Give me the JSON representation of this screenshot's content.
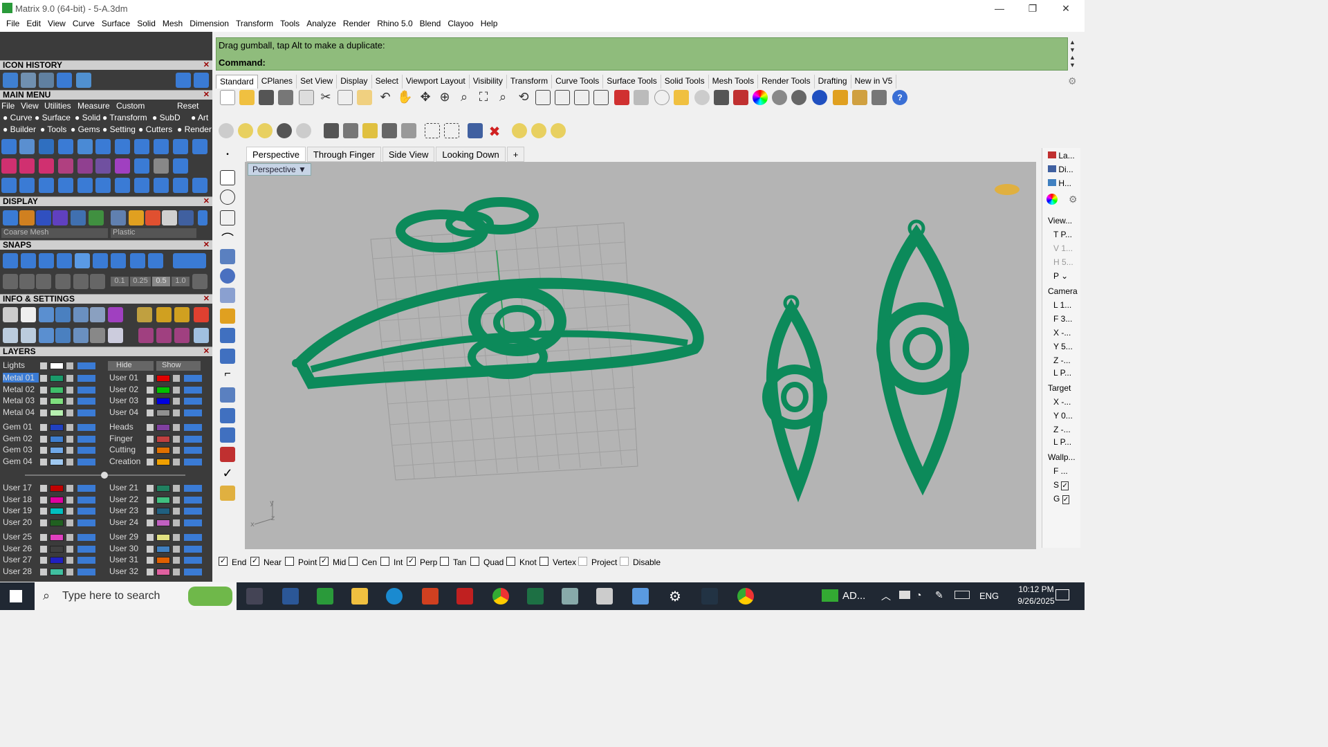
{
  "window": {
    "title": "Matrix 9.0 (64-bit) - 5-A.3dm",
    "minimize": "—",
    "restore": "❐",
    "close": "✕"
  },
  "menu": [
    "File",
    "Edit",
    "View",
    "Curve",
    "Surface",
    "Solid",
    "Mesh",
    "Dimension",
    "Transform",
    "Tools",
    "Analyze",
    "Render",
    "Rhino 5.0",
    "Blend",
    "Clayoo",
    "Help"
  ],
  "left": {
    "icon_history": "ICON HISTORY",
    "main_menu": "MAIN MENU",
    "main_menu_items": [
      "File",
      "View",
      "Utilities",
      "Measure",
      "Custom",
      "Reset"
    ],
    "builder_row1": [
      "Curve",
      "Surface",
      "Solid",
      "Transform",
      "SubD",
      "Art"
    ],
    "builder_row2": [
      "Builder",
      "Tools",
      "Gems",
      "Setting",
      "Cutters",
      "Render"
    ],
    "display": "DISPLAY",
    "display_mesh": "Coarse Mesh",
    "display_material": "Plastic",
    "snaps": "SNAPS",
    "snap_values": [
      "0.1",
      "0.25",
      "0.5",
      "1.0"
    ],
    "info": "INFO & SETTINGS",
    "layers": "LAYERS",
    "lights": "Lights",
    "hide": "Hide",
    "show": "Show",
    "layer_left": [
      {
        "name": "Metal 01",
        "color": "#1a9a6a"
      },
      {
        "name": "Metal 02",
        "color": "#3fbf6a"
      },
      {
        "name": "Metal 03",
        "color": "#7fdf7f"
      },
      {
        "name": "Metal 04",
        "color": "#b7f0b0"
      },
      {
        "name": "Gem 01",
        "color": "#2040c0"
      },
      {
        "name": "Gem 02",
        "color": "#3f7fd0"
      },
      {
        "name": "Gem 03",
        "color": "#6fa8e8"
      },
      {
        "name": "Gem 04",
        "color": "#9fc8f0"
      }
    ],
    "layer_right": [
      {
        "name": "User 01",
        "color": "#e00000"
      },
      {
        "name": "User 02",
        "color": "#00c000"
      },
      {
        "name": "User 03",
        "color": "#0000e0"
      },
      {
        "name": "User 04",
        "color": "#909090"
      },
      {
        "name": "Heads",
        "color": "#8040a0"
      },
      {
        "name": "Finger",
        "color": "#c04040"
      },
      {
        "name": "Cutting",
        "color": "#e07000"
      },
      {
        "name": "Creation",
        "color": "#f0a000"
      }
    ],
    "layer_left2": [
      {
        "name": "User 17",
        "color": "#c00000"
      },
      {
        "name": "User 18",
        "color": "#e000a0"
      },
      {
        "name": "User 19",
        "color": "#00c0c0"
      },
      {
        "name": "User 20",
        "color": "#206020"
      },
      {
        "name": "User 25",
        "color": "#e040c0"
      },
      {
        "name": "User 26",
        "color": "#404040"
      },
      {
        "name": "User 27",
        "color": "#2020c0"
      },
      {
        "name": "User 28",
        "color": "#40c0a0"
      }
    ],
    "layer_right2": [
      {
        "name": "User 21",
        "color": "#208060"
      },
      {
        "name": "User 22",
        "color": "#40c080"
      },
      {
        "name": "User 23",
        "color": "#206080"
      },
      {
        "name": "User 24",
        "color": "#c060c0"
      },
      {
        "name": "User 29",
        "color": "#e0e080"
      },
      {
        "name": "User 30",
        "color": "#4080c0"
      },
      {
        "name": "User 31",
        "color": "#e06000"
      },
      {
        "name": "User 32",
        "color": "#e060a0"
      }
    ]
  },
  "command": {
    "prompt": "Drag gumball, tap Alt to make a duplicate:",
    "label": "Command:"
  },
  "tabs": [
    "Standard",
    "CPlanes",
    "Set View",
    "Display",
    "Select",
    "Viewport Layout",
    "Visibility",
    "Transform",
    "Curve Tools",
    "Surface Tools",
    "Solid Tools",
    "Mesh Tools",
    "Render Tools",
    "Drafting",
    "New in V5"
  ],
  "viewport_tabs": [
    "Perspective",
    "Through Finger",
    "Side View",
    "Looking Down",
    "+"
  ],
  "viewport_label": "Perspective",
  "right": {
    "tabs": [
      "La...",
      "Di...",
      "H..."
    ],
    "view": "View...",
    "view_rows": [
      "T",
      "P...",
      "V",
      "1...",
      "H",
      "5...",
      "P"
    ],
    "camera": "Camera",
    "camera_rows": [
      "L 1...",
      "F 3...",
      "X -...",
      "Y 5...",
      "Z -...",
      "L P..."
    ],
    "target": "Target",
    "target_rows": [
      "X -...",
      "Y 0...",
      "Z -...",
      "L P..."
    ],
    "wallp": "Wallp...",
    "wallp_rows": [
      "F ...",
      "S",
      "G"
    ]
  },
  "osnap": [
    {
      "label": "End",
      "checked": true
    },
    {
      "label": "Near",
      "checked": true
    },
    {
      "label": "Point",
      "checked": false
    },
    {
      "label": "Mid",
      "checked": true
    },
    {
      "label": "Cen",
      "checked": false
    },
    {
      "label": "Int",
      "checked": false
    },
    {
      "label": "Perp",
      "checked": true
    },
    {
      "label": "Tan",
      "checked": false
    },
    {
      "label": "Quad",
      "checked": false
    },
    {
      "label": "Knot",
      "checked": false
    },
    {
      "label": "Vertex",
      "checked": false
    },
    {
      "label": "Project",
      "checked": false
    },
    {
      "label": "Disable",
      "checked": false
    }
  ],
  "taskbar": {
    "search_placeholder": "Type here to search",
    "time": "10:12 PM",
    "date": "9/26/2025",
    "lang": "ENG",
    "app_label": "AD..."
  },
  "colors": {
    "accent": "#3a7bd5",
    "model": "#0c8a5a",
    "cmd_bg": "#8fbc7c"
  }
}
